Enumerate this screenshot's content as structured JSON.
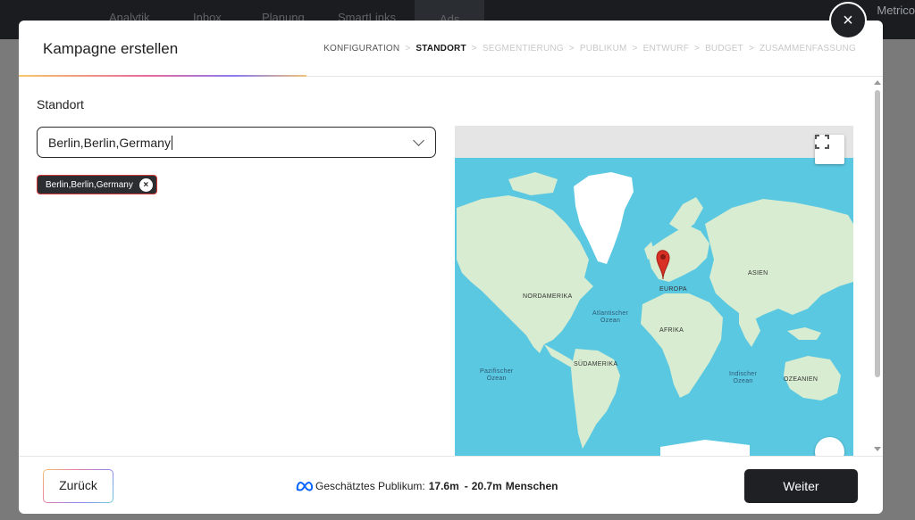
{
  "backdrop": {
    "nav": [
      "Analytik",
      "Inbox",
      "Planung",
      "SmartLinks",
      "Ads"
    ],
    "active_nav": "Ads",
    "right_label": "Metrico"
  },
  "modal": {
    "title": "Kampagne erstellen",
    "close_label": "×",
    "steps": [
      {
        "label": "KONFIGURATION",
        "state": "done"
      },
      {
        "label": "STANDORT",
        "state": "active"
      },
      {
        "label": "SEGMENTIERUNG",
        "state": "pending"
      },
      {
        "label": "PUBLIKUM",
        "state": "pending"
      },
      {
        "label": "ENTWURF",
        "state": "pending"
      },
      {
        "label": "BUDGET",
        "state": "pending"
      },
      {
        "label": "ZUSAMMENFASSUNG",
        "state": "pending"
      }
    ],
    "step_separator": ">",
    "location": {
      "section_label": "Standort",
      "input_value": "Berlin,Berlin,Germany",
      "selected_tag": "Berlin,Berlin,Germany",
      "tag_remove": "×"
    },
    "map": {
      "labels": {
        "north_america": "NORDAMERIKA",
        "europe": "EUROPA",
        "asia": "ASIEN",
        "africa": "AFRIKA",
        "south_america": "SÜDAMERIKA",
        "oceania": "OZEANIEN",
        "atlantic_1": "Atlantischer",
        "atlantic_2": "Ozean",
        "pacific_1": "Pazifischer",
        "pacific_2": "Ozean",
        "indian_1": "Indischer",
        "indian_2": "Ozean"
      },
      "marker": "Berlin",
      "ocean_color": "#5bc8e2",
      "land_color": "#d7ecd0",
      "marker_color": "#d93025"
    },
    "footer": {
      "back_label": "Zurück",
      "audience_prefix": "Geschätztes Publikum:",
      "audience_min": "17.6m",
      "audience_dash": "-",
      "audience_max": "20.7m",
      "audience_suffix": "Menschen",
      "next_label": "Weiter"
    }
  }
}
